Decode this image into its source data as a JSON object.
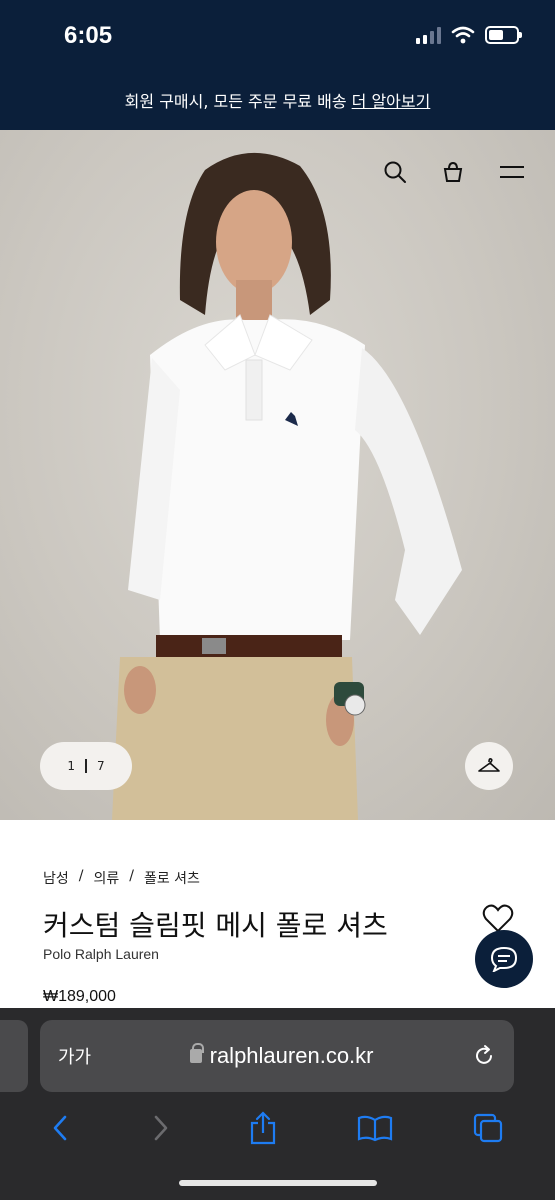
{
  "status": {
    "time": "6:05"
  },
  "promo": {
    "text": "회원 구매시, 모든 주문 무료 배송 ",
    "link": "더 알아보기"
  },
  "gallery": {
    "current": "1",
    "total": "7"
  },
  "product": {
    "breadcrumbs": [
      "남성",
      "/",
      "의류",
      "/",
      "폴로 셔츠"
    ],
    "title": "커스텀 슬림핏 메시 폴로 셔츠",
    "brand": "Polo Ralph Lauren",
    "price": "₩189,000"
  },
  "browser": {
    "text_size": "가가",
    "url": "ralphlauren.co.kr"
  },
  "colors": {
    "navy": "#0b1f3a",
    "accent": "#1e7cf2"
  },
  "icons": [
    "search-icon",
    "shopping-bag-icon",
    "menu-icon",
    "hanger-icon",
    "heart-icon",
    "chat-icon",
    "lock-icon",
    "reload-icon",
    "back-icon",
    "forward-icon",
    "share-icon",
    "bookmarks-icon",
    "tabs-icon"
  ]
}
